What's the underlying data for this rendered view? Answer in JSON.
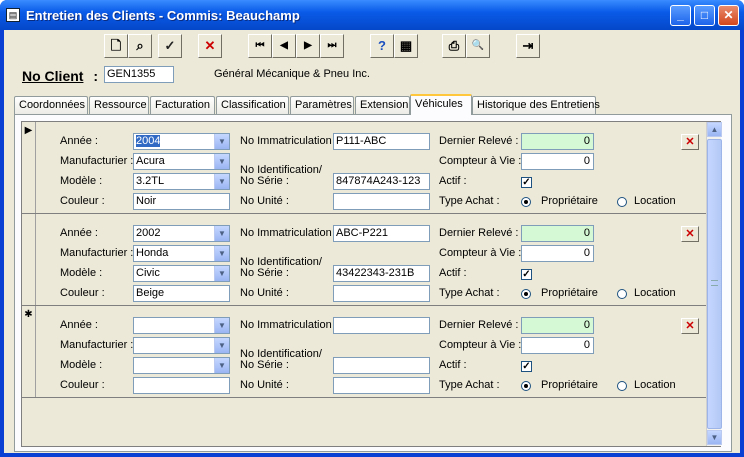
{
  "window": {
    "title": "Entretien des Clients - Commis: Beauchamp"
  },
  "titlebar_buttons": [
    {
      "name": "minimize",
      "glyph": "_"
    },
    {
      "name": "maximize",
      "glyph": "□"
    },
    {
      "name": "close",
      "glyph": "✕"
    }
  ],
  "toolbar": {
    "new_glyph": "🗋",
    "find_glyph": "⌕",
    "save_glyph": "✓",
    "cancel_glyph": "✕",
    "first_glyph": "⏮",
    "prev_glyph": "◀",
    "next_glyph": "▶",
    "last_glyph": "⏭",
    "help_glyph": "?",
    "calc_glyph": "▦",
    "print_glyph": "⎙",
    "preview_glyph": "🔍",
    "exit_glyph": "⇥"
  },
  "client": {
    "label": "No Client",
    "colon": ":",
    "id": "GEN1355",
    "name": "Général Mécanique & Pneu Inc."
  },
  "tabs": [
    "Coordonnées",
    "Ressource",
    "Facturation",
    "Classification",
    "Paramètres",
    "Extension",
    "Véhicules",
    "Historique des Entretiens"
  ],
  "active_tab": "Véhicules",
  "labels": {
    "annee": "Année :",
    "manufacturier": "Manufacturier :",
    "modele": "Modèle :",
    "couleur": "Couleur :",
    "no_immatriculation": "No Immatriculation :",
    "no_identification": "No Identification/",
    "no_serie": "No Série :",
    "no_unite": "No Unité :",
    "dernier_releve": "Dernier Relevé :",
    "compteur_vie": "Compteur à Vie :",
    "actif": "Actif :",
    "type_achat": "Type Achat :",
    "proprietaire": "Propriétaire",
    "location": "Location"
  },
  "records": [
    {
      "selector": "▶",
      "annee": "2004",
      "manufacturier": "Acura",
      "modele": "3.2TL",
      "couleur": "Noir",
      "immatriculation": "P111-ABC",
      "serie": "847874A243-123",
      "unite": "",
      "dernier_releve": "0",
      "compteur_vie": "0",
      "actif": "✓",
      "type_achat": "proprietaire",
      "delete_glyph": "✕"
    },
    {
      "selector": "",
      "annee": "2002",
      "manufacturier": "Honda",
      "modele": "Civic",
      "couleur": "Beige",
      "immatriculation": "ABC-P221",
      "serie": "43422343-231B",
      "unite": "",
      "dernier_releve": "0",
      "compteur_vie": "0",
      "actif": "✓",
      "type_achat": "proprietaire",
      "delete_glyph": "✕"
    },
    {
      "selector": "✱",
      "annee": "",
      "manufacturier": "",
      "modele": "",
      "couleur": "",
      "immatriculation": "",
      "serie": "",
      "unite": "",
      "dernier_releve": "0",
      "compteur_vie": "0",
      "actif": "✓",
      "type_achat": "proprietaire",
      "delete_glyph": "✕"
    }
  ],
  "scrollbar": {
    "up": "▲",
    "down": "▼"
  }
}
